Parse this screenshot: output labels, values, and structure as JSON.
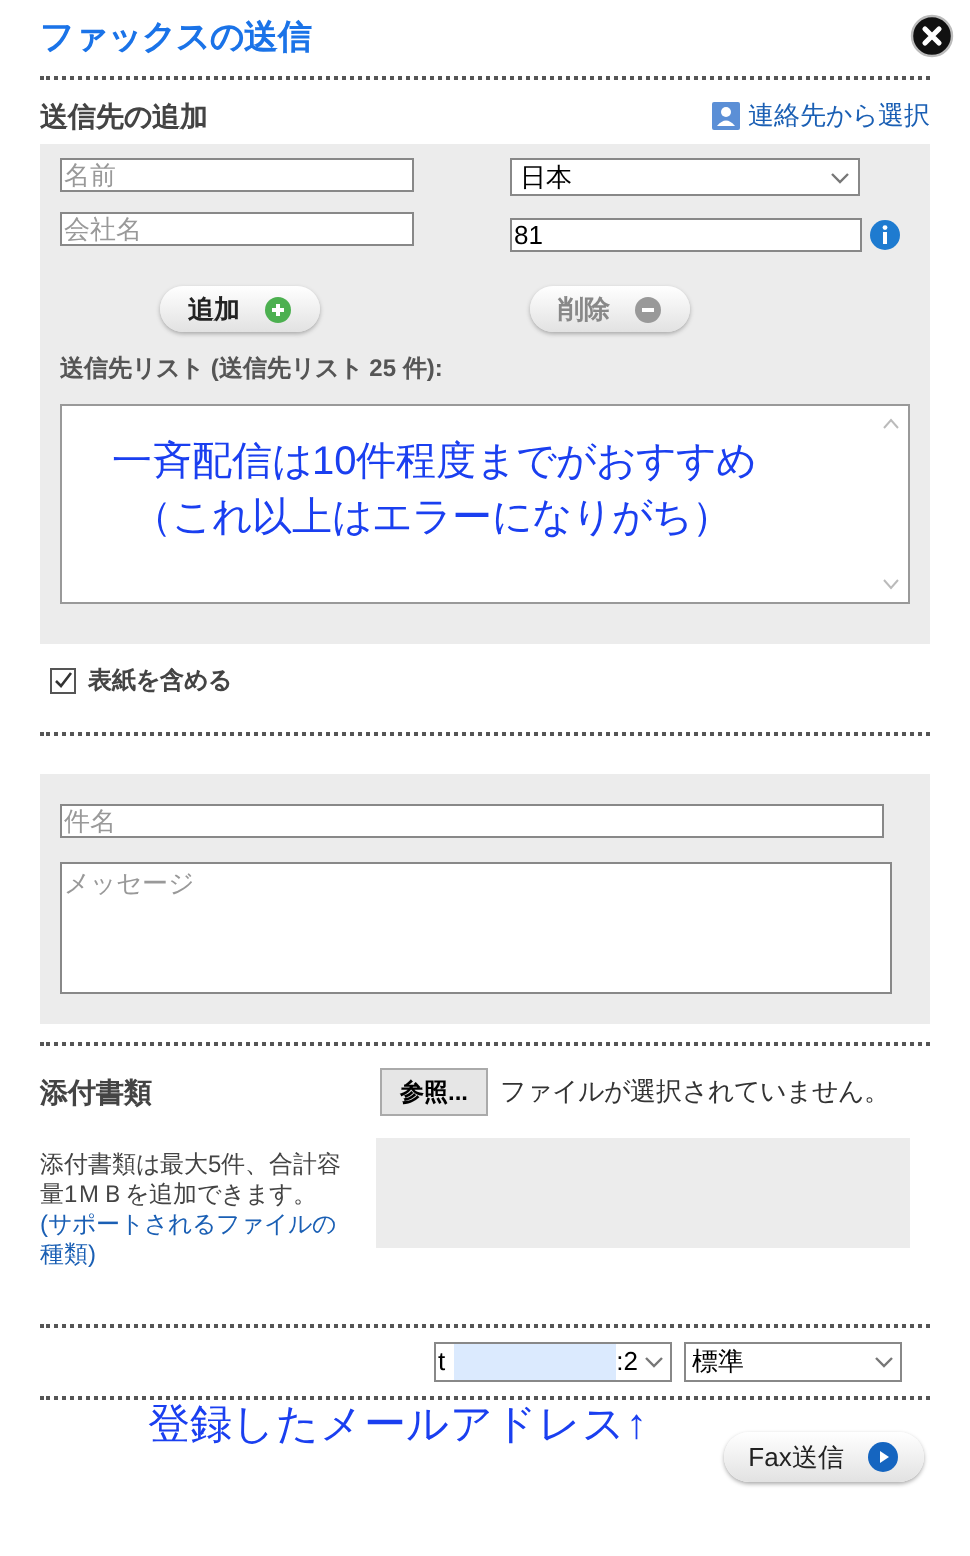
{
  "title": "ファックスの送信",
  "recipient_section": {
    "heading": "送信先の追加",
    "contacts_link": "連絡先から選択",
    "name_field": {
      "placeholder": "名前"
    },
    "company_field": {
      "placeholder": "会社名"
    },
    "country_select": {
      "value": "日本"
    },
    "fax_field": {
      "value": "81"
    },
    "add_button": {
      "label": "追加",
      "disabled": false
    },
    "delete_button": {
      "label": "削除",
      "disabled": true
    },
    "list_label": "送信先リスト (送信先リスト 25 件):",
    "list_annotation": [
      "一斉配信は10件程度までがおすすめ",
      "（これ以上はエラーになりがち）"
    ]
  },
  "cover_page": {
    "label": "表紙を含める",
    "checked": true
  },
  "message_section": {
    "subject_field": {
      "placeholder": "件名"
    },
    "message_field": {
      "placeholder": "メッセージ"
    }
  },
  "attachments": {
    "heading": "添付書類",
    "browse_button": "参照...",
    "no_file_text": "ファイルが選択されていません。",
    "help_text": "添付書類は最大5件、合計容量1ＭＢを追加できます。",
    "help_link": "(サポートされるファイルの種類)"
  },
  "sender_select": {
    "value_start": "t",
    "value_end": ":2"
  },
  "quality_select": {
    "value": "標準"
  },
  "email_annotation": "登録したメールアドレス↑",
  "send_button": "Fax送信"
}
